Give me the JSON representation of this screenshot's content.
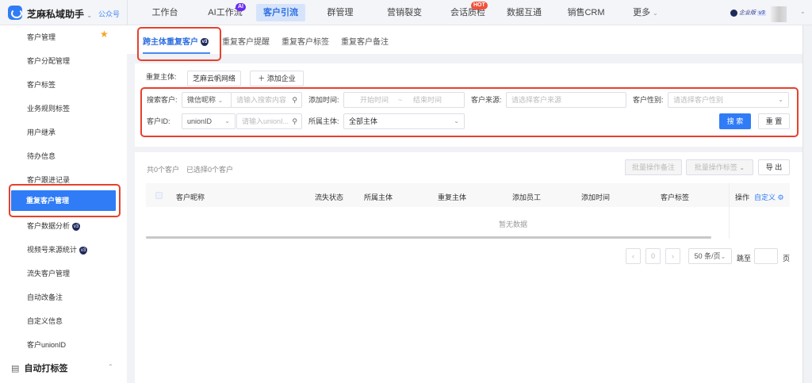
{
  "app": {
    "name": "芝麻私域助手",
    "account_type": "公众号",
    "edition": "企业版",
    "version": "v3"
  },
  "nav": [
    {
      "label": "工作台"
    },
    {
      "label": "AI工作流",
      "badge": "AI"
    },
    {
      "label": "客户引流",
      "active": true
    },
    {
      "label": "群管理"
    },
    {
      "label": "营销裂变"
    },
    {
      "label": "会话质检",
      "badge": "HOT"
    },
    {
      "label": "数据互通"
    },
    {
      "label": "销售CRM"
    },
    {
      "label": "更多"
    }
  ],
  "sidebar": {
    "items": [
      "客户管理",
      "客户分配管理",
      "客户标签",
      "业务规则标签",
      "用户继承",
      "待办信息",
      "客户跟进记录",
      "重复客户管理",
      "客户数据分析",
      "视频号来源统计",
      "流失客户管理",
      "自动改备注",
      "自定义信息",
      "客户unionID"
    ],
    "active": "重复客户管理",
    "vip_badge": "v3",
    "section": "自动打标签"
  },
  "tabs": [
    "跨主体重复客户",
    "重复客户提醒",
    "重复客户标签",
    "重复客户备注"
  ],
  "filters": {
    "dup_subject_label": "重复主体:",
    "dup_subject_value": "芝麻云帆网络",
    "add_company": "添加企业",
    "search_label": "搜索客户:",
    "search_type": "微信昵称",
    "search_placeholder": "请输入搜索内容",
    "time_label": "添加时间:",
    "start_placeholder": "开始时间",
    "sep": "~",
    "end_placeholder": "结束时间",
    "source_label": "客户来源:",
    "source_placeholder": "请选择客户来源",
    "gender_label": "客户性别:",
    "gender_placeholder": "请选择客户性别",
    "id_label": "客户ID:",
    "id_type": "unionID",
    "id_placeholder": "请输入unionI...",
    "owner_label": "所属主体:",
    "owner_value": "全部主体",
    "search_btn": "搜 索",
    "reset_btn": "重 置"
  },
  "table": {
    "total": "共0个客户",
    "selected": "已选择0个客户",
    "batch_remark": "批量操作备注",
    "batch_tag": "批量操作标签",
    "export": "导 出",
    "columns": [
      "客户昵称",
      "流失状态",
      "所属主体",
      "重复主体",
      "添加员工",
      "添加时间",
      "客户标签"
    ],
    "action_col": "操作",
    "customize": "自定义",
    "empty": "暂无数据"
  },
  "pagination": {
    "page": "0",
    "page_size": "50 条/页",
    "jump": "跳至",
    "page_unit": "页"
  }
}
